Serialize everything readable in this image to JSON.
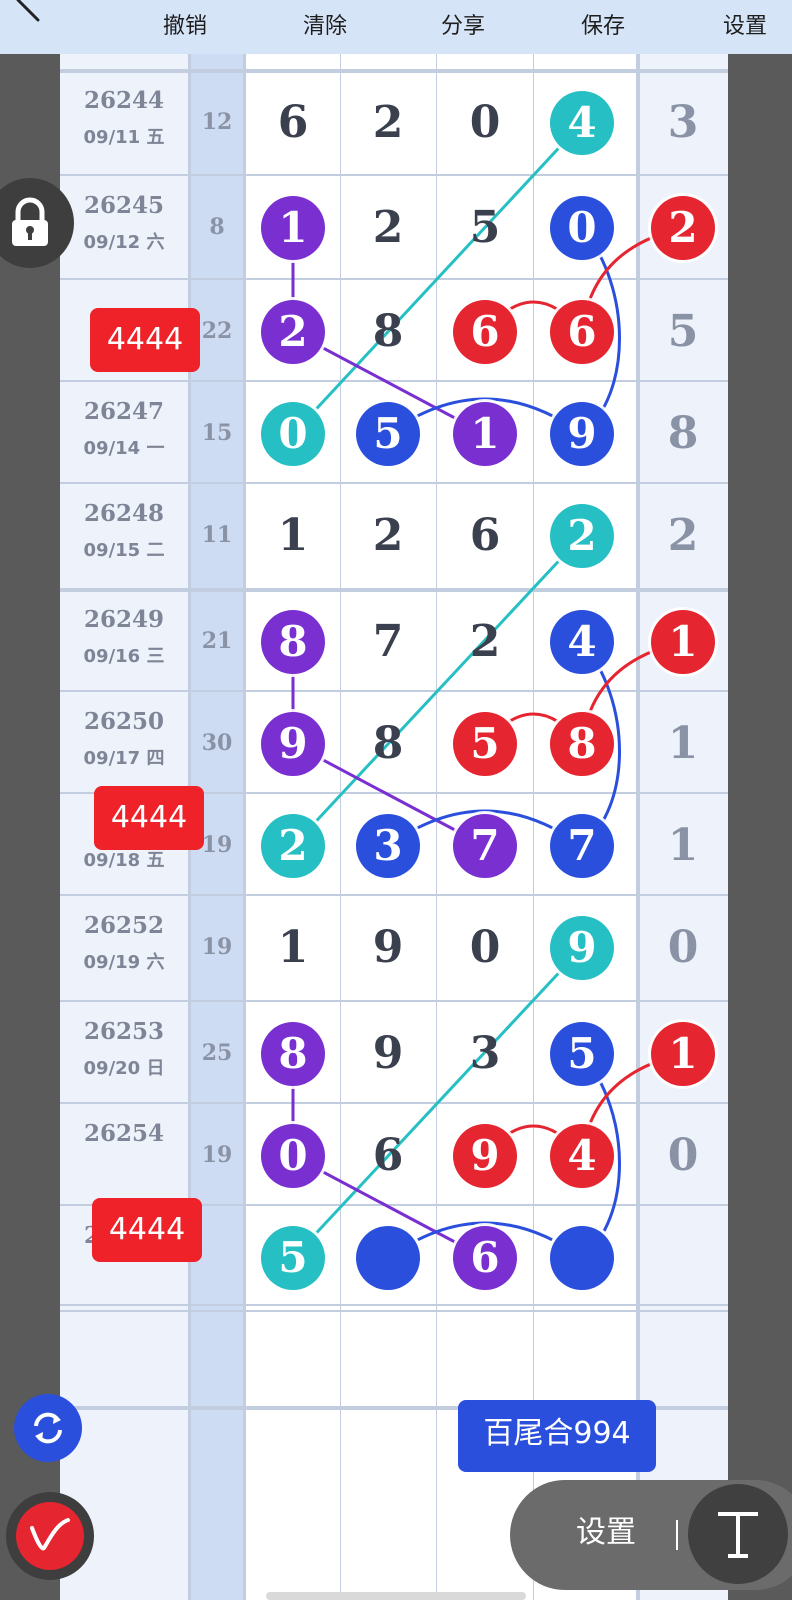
{
  "toolbar": {
    "undo": "撤销",
    "clear": "清除",
    "share": "分享",
    "save": "保存",
    "settings": "设置"
  },
  "rows": [
    {
      "id": "26244",
      "date": "09/11 五",
      "sum": "12",
      "d": [
        "6",
        "2",
        "0",
        "4"
      ],
      "tail": "3"
    },
    {
      "id": "26245",
      "date": "09/12 六",
      "sum": "8",
      "d": [
        "1",
        "2",
        "5",
        "0"
      ],
      "tail": "2"
    },
    {
      "id": "",
      "date": "",
      "sum": "22",
      "d": [
        "2",
        "8",
        "6",
        "6"
      ],
      "tail": "5"
    },
    {
      "id": "26247",
      "date": "09/14 一",
      "sum": "15",
      "d": [
        "0",
        "5",
        "1",
        "9"
      ],
      "tail": "8"
    },
    {
      "id": "26248",
      "date": "09/15 二",
      "sum": "11",
      "d": [
        "1",
        "2",
        "6",
        "2"
      ],
      "tail": "2"
    },
    {
      "id": "26249",
      "date": "09/16 三",
      "sum": "21",
      "d": [
        "8",
        "7",
        "2",
        "4"
      ],
      "tail": "1"
    },
    {
      "id": "26250",
      "date": "09/17 四",
      "sum": "30",
      "d": [
        "9",
        "8",
        "5",
        "8"
      ],
      "tail": "1"
    },
    {
      "id": "",
      "date": "09/18 五",
      "sum": "19",
      "d": [
        "2",
        "3",
        "7",
        "7"
      ],
      "tail": "1"
    },
    {
      "id": "26252",
      "date": "09/19 六",
      "sum": "19",
      "d": [
        "1",
        "9",
        "0",
        "9"
      ],
      "tail": "0"
    },
    {
      "id": "26253",
      "date": "09/20 日",
      "sum": "25",
      "d": [
        "8",
        "9",
        "3",
        "5"
      ],
      "tail": "1"
    },
    {
      "id": "26254",
      "date": "",
      "sum": "19",
      "d": [
        "0",
        "6",
        "9",
        "4"
      ],
      "tail": "0"
    },
    {
      "id": "26255",
      "date": "",
      "sum": "",
      "d": [
        "5",
        "",
        "6",
        ""
      ],
      "tail": ""
    }
  ],
  "badges": [
    "4444",
    "4444",
    "4444"
  ],
  "total_label": "百尾合994",
  "settings_pill": {
    "label": "设置"
  },
  "colors": {
    "purple": "#7a2fd1",
    "blue": "#2a4fdc",
    "red": "#e5252f",
    "teal": "#26c0c4",
    "toolbar_bg": "#d6e4f7"
  }
}
